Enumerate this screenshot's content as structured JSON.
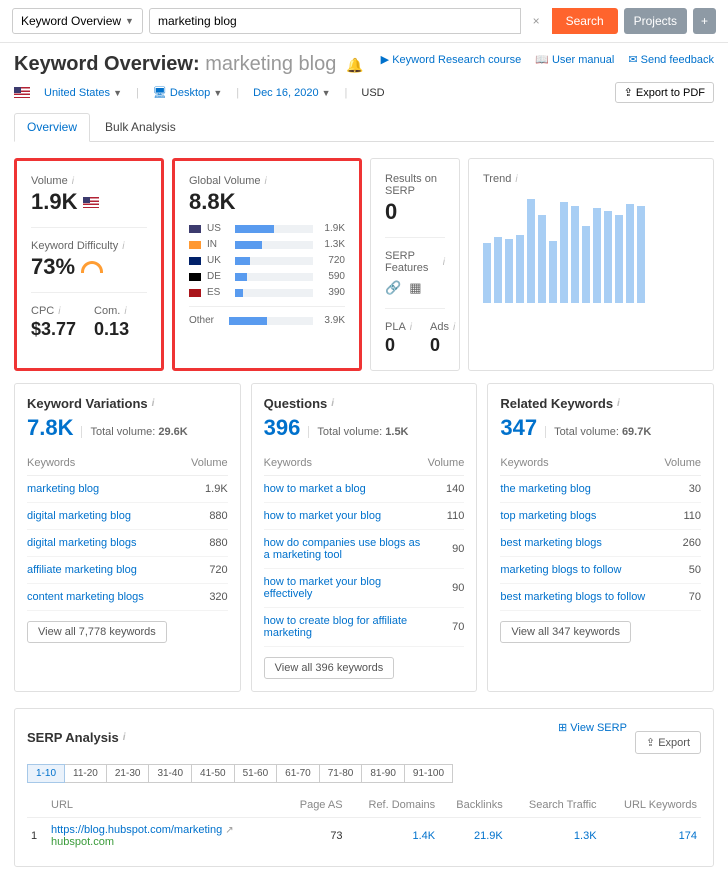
{
  "topbar": {
    "keyword_overview_btn": "Keyword Overview",
    "search_value": "marketing blog",
    "search_btn": "Search",
    "projects_btn": "Projects",
    "plus_btn": "+"
  },
  "header": {
    "title_prefix": "Keyword Overview:",
    "keyword": "marketing blog",
    "links": {
      "course": "Keyword Research course",
      "manual": "User manual",
      "feedback": "Send feedback"
    },
    "filters": {
      "country": "United States",
      "device": "Desktop",
      "date": "Dec 16, 2020",
      "currency": "USD"
    },
    "export_pdf": "Export to PDF"
  },
  "tabs": {
    "overview": "Overview",
    "bulk": "Bulk Analysis"
  },
  "card1": {
    "volume_label": "Volume",
    "volume_value": "1.9K",
    "kd_label": "Keyword Difficulty",
    "kd_value": "73%",
    "cpc_label": "CPC",
    "cpc_value": "$3.77",
    "com_label": "Com.",
    "com_value": "0.13"
  },
  "card2": {
    "label": "Global Volume",
    "value": "8.8K",
    "rows": [
      {
        "flag": "fl-us",
        "cc": "US",
        "pct": 50,
        "val": "1.9K"
      },
      {
        "flag": "fl-in",
        "cc": "IN",
        "pct": 34,
        "val": "1.3K"
      },
      {
        "flag": "fl-uk",
        "cc": "UK",
        "pct": 19,
        "val": "720"
      },
      {
        "flag": "fl-de",
        "cc": "DE",
        "pct": 15,
        "val": "590"
      },
      {
        "flag": "fl-es",
        "cc": "ES",
        "pct": 10,
        "val": "390"
      }
    ],
    "other_label": "Other",
    "other_pct": 45,
    "other_val": "3.9K"
  },
  "card3": {
    "results_label": "Results on SERP",
    "results_value": "0",
    "features_label": "SERP Features",
    "pla_label": "PLA",
    "pla_value": "0",
    "ads_label": "Ads",
    "ads_value": "0"
  },
  "card4": {
    "label": "Trend",
    "heights": [
      55,
      60,
      58,
      62,
      95,
      80,
      56,
      92,
      88,
      70,
      86,
      84,
      80,
      90,
      88
    ]
  },
  "variations": {
    "title": "Keyword Variations",
    "count": "7.8K",
    "total_label": "Total volume:",
    "total_value": "29.6K",
    "col1": "Keywords",
    "col2": "Volume",
    "rows": [
      {
        "kw": "marketing blog",
        "vol": "1.9K"
      },
      {
        "kw": "digital marketing blog",
        "vol": "880"
      },
      {
        "kw": "digital marketing blogs",
        "vol": "880"
      },
      {
        "kw": "affiliate marketing blog",
        "vol": "720"
      },
      {
        "kw": "content marketing blogs",
        "vol": "320"
      }
    ],
    "view_all": "View all 7,778 keywords"
  },
  "questions": {
    "title": "Questions",
    "count": "396",
    "total_label": "Total volume:",
    "total_value": "1.5K",
    "col1": "Keywords",
    "col2": "Volume",
    "rows": [
      {
        "kw": "how to market a blog",
        "vol": "140"
      },
      {
        "kw": "how to market your blog",
        "vol": "110"
      },
      {
        "kw": "how do companies use blogs as a marketing tool",
        "vol": "90"
      },
      {
        "kw": "how to market your blog effectively",
        "vol": "90"
      },
      {
        "kw": "how to create blog for affiliate marketing",
        "vol": "70"
      }
    ],
    "view_all": "View all 396 keywords"
  },
  "related": {
    "title": "Related Keywords",
    "count": "347",
    "total_label": "Total volume:",
    "total_value": "69.7K",
    "col1": "Keywords",
    "col2": "Volume",
    "rows": [
      {
        "kw": "the marketing blog",
        "vol": "30"
      },
      {
        "kw": "top marketing blogs",
        "vol": "110"
      },
      {
        "kw": "best marketing blogs",
        "vol": "260"
      },
      {
        "kw": "marketing blogs to follow",
        "vol": "50"
      },
      {
        "kw": "best marketing blogs to follow",
        "vol": "70"
      }
    ],
    "view_all": "View all 347 keywords"
  },
  "serp": {
    "title": "SERP Analysis",
    "view_serp": "View SERP",
    "export": "Export",
    "pages": [
      "1-10",
      "11-20",
      "21-30",
      "31-40",
      "41-50",
      "51-60",
      "61-70",
      "71-80",
      "81-90",
      "91-100"
    ],
    "cols": {
      "url": "URL",
      "pageas": "Page AS",
      "ref": "Ref. Domains",
      "back": "Backlinks",
      "traffic": "Search Traffic",
      "kw": "URL Keywords"
    },
    "rows": [
      {
        "n": "1",
        "url": "https://blog.hubspot.com/marketing",
        "domain": "hubspot.com",
        "pageas": "73",
        "ref": "1.4K",
        "back": "21.9K",
        "traffic": "1.3K",
        "kw": "174"
      }
    ]
  }
}
